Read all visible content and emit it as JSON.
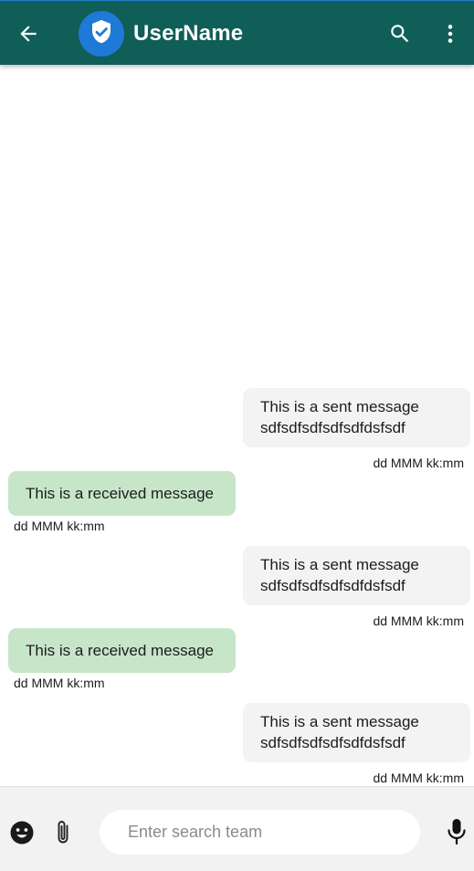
{
  "header": {
    "title": "UserName",
    "back_icon": "arrow-left-icon",
    "avatar_icon": "shield-check-icon",
    "search_icon": "search-icon",
    "menu_icon": "more-vertical-icon",
    "background_color": "#0f5e57",
    "avatar_color": "#1f79d6"
  },
  "messages": [
    {
      "direction": "sent",
      "line1": "This is a sent message",
      "line2": "sdfsdfsdfsdfsdfdsfsdf",
      "timestamp": "dd MMM kk:mm"
    },
    {
      "direction": "received",
      "line1": "This is a received message",
      "timestamp": "dd MMM kk:mm"
    },
    {
      "direction": "sent",
      "line1": "This is a sent message",
      "line2": "sdfsdfsdfsdfsdfdsfsdf",
      "timestamp": "dd MMM kk:mm"
    },
    {
      "direction": "received",
      "line1": "This is a received message",
      "timestamp": "dd MMM kk:mm"
    },
    {
      "direction": "sent",
      "line1": "This is a sent message",
      "line2": "sdfsdfsdfsdfsdfdsfsdf",
      "timestamp": "dd MMM kk:mm"
    }
  ],
  "bubble_colors": {
    "sent": "#f3f3f3",
    "received": "#c7e6c9"
  },
  "composer": {
    "placeholder": "Enter search team",
    "emoji_icon": "emoji-icon",
    "attach_icon": "paperclip-icon",
    "mic_icon": "microphone-icon"
  }
}
